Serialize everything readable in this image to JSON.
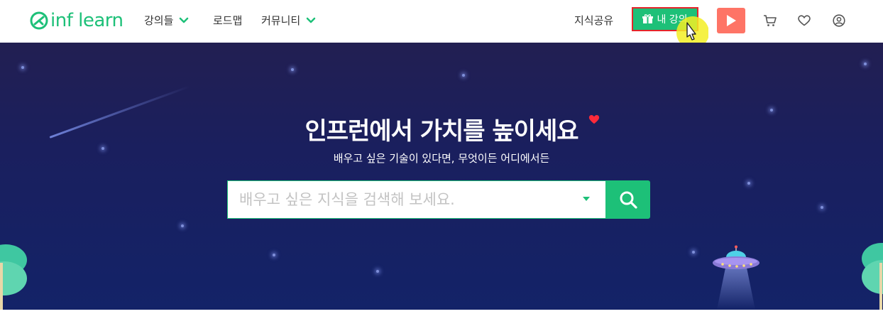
{
  "header": {
    "logo_text": "inf learn",
    "nav": [
      {
        "label": "강의들",
        "has_dropdown": true
      },
      {
        "label": "로드맵",
        "has_dropdown": false
      },
      {
        "label": "커뮤니티",
        "has_dropdown": true
      }
    ],
    "share_label": "지식공유",
    "my_course_label": "내 강의",
    "icons": [
      "gift-icon",
      "play-icon",
      "cart-icon",
      "heart-icon",
      "user-icon"
    ]
  },
  "hero": {
    "title": "인프런에서 가치를 높이세요",
    "subtitle": "배우고 싶은 기술이 있다면, 무엇이든 어디에서든",
    "search_placeholder": "배우고 싶은 지식을 검색해 보세요.",
    "search_value": ""
  },
  "colors": {
    "brand_green": "#1dc078",
    "play_orange": "#fe7466",
    "hero_bg": "#1a1f5e",
    "highlight_border": "#e5252a"
  }
}
